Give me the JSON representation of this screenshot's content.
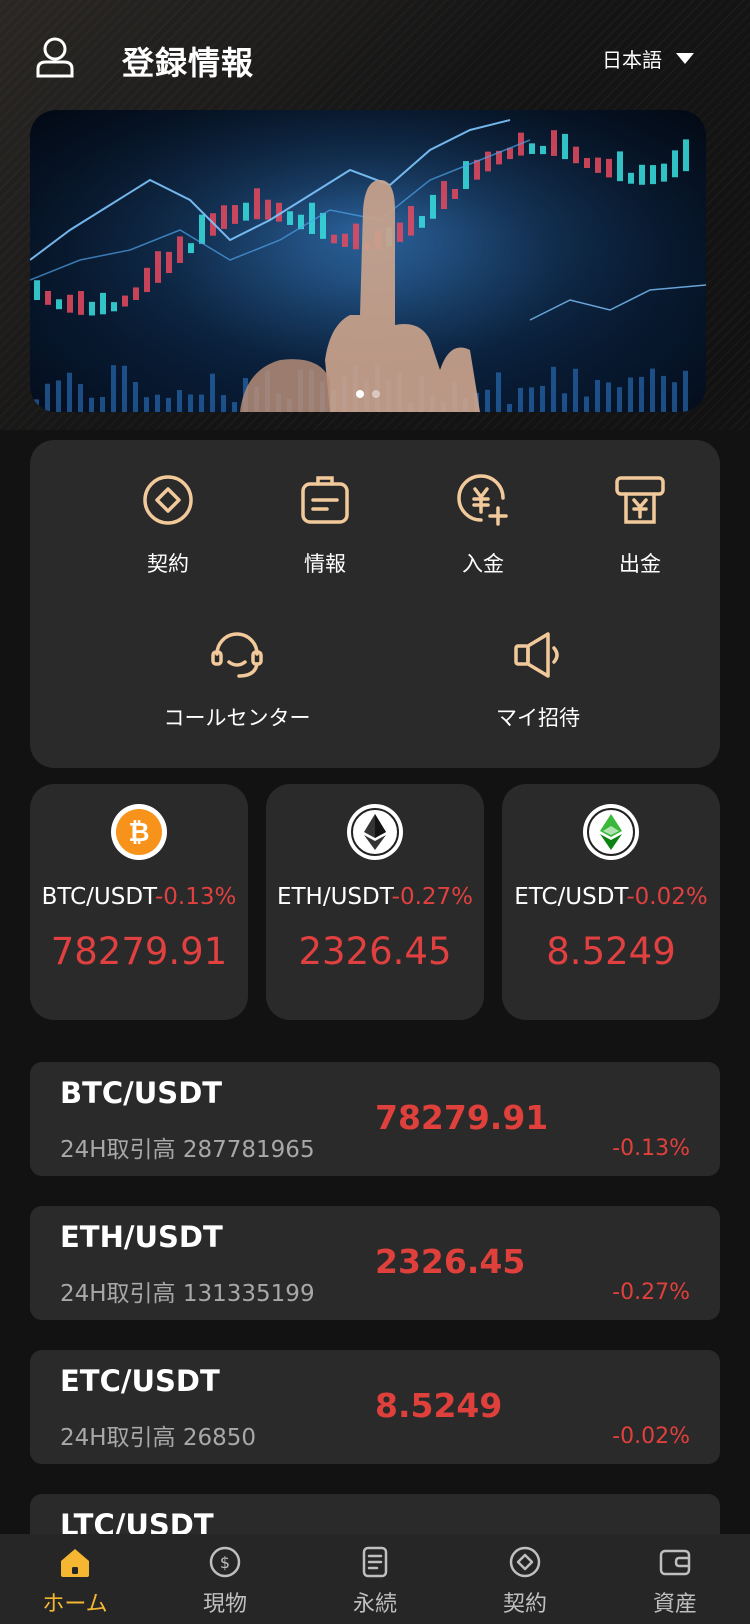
{
  "header": {
    "title": "登録情報",
    "language": "日本語"
  },
  "banner": {
    "slide_count": 2,
    "active_slide": 1
  },
  "menu": {
    "items": [
      {
        "label": "契約",
        "icon": "contract-diamond-icon"
      },
      {
        "label": "情報",
        "icon": "info-card-icon"
      },
      {
        "label": "入金",
        "icon": "deposit-yen-icon"
      },
      {
        "label": "出金",
        "icon": "withdraw-yen-icon"
      },
      {
        "label": "コールセンター",
        "icon": "headset-icon"
      },
      {
        "label": "マイ招待",
        "icon": "megaphone-icon"
      }
    ]
  },
  "coins": [
    {
      "pair": "BTC/USDT",
      "change": "-0.13%",
      "price": "78279.91",
      "icon": "bitcoin-icon"
    },
    {
      "pair": "ETH/USDT",
      "change": "-0.27%",
      "price": "2326.45",
      "icon": "ethereum-icon"
    },
    {
      "pair": "ETC/USDT",
      "change": "-0.02%",
      "price": "8.5249",
      "icon": "ethereum-classic-icon"
    }
  ],
  "market": {
    "rows": [
      {
        "pair": "BTC/USDT",
        "volume": "24H取引高 287781965",
        "price": "78279.91",
        "change": "-0.13%"
      },
      {
        "pair": "ETH/USDT",
        "volume": "24H取引高 131335199",
        "price": "2326.45",
        "change": "-0.27%"
      },
      {
        "pair": "ETC/USDT",
        "volume": "24H取引高 26850",
        "price": "8.5249",
        "change": "-0.02%"
      },
      {
        "pair": "LTC/USDT"
      }
    ]
  },
  "tabs": [
    {
      "label": "ホーム",
      "icon": "home-icon",
      "active": true
    },
    {
      "label": "現物",
      "icon": "dollar-coin-icon",
      "active": false
    },
    {
      "label": "永続",
      "icon": "document-icon",
      "active": false
    },
    {
      "label": "契約",
      "icon": "contract-diamond-icon",
      "active": false
    },
    {
      "label": "資産",
      "icon": "wallet-icon",
      "active": false
    }
  ],
  "colors": {
    "accent": "#f5b731",
    "icon_gold": "#f2c99a",
    "negative": "#e0403c",
    "card_bg": "#2a2a2a",
    "page_bg": "#121212"
  }
}
